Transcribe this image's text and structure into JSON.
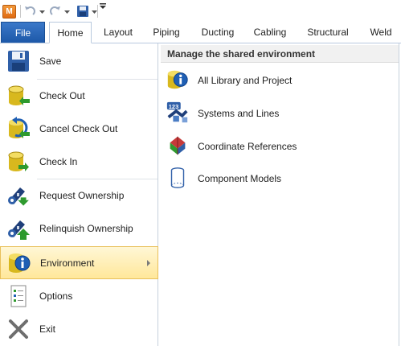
{
  "app": {
    "icon_letter": "M"
  },
  "qat": {
    "icons": [
      "app-icon",
      "undo-icon",
      "redo-icon",
      "save-icon",
      "customize-icon"
    ]
  },
  "ribbon": {
    "file_label": "File",
    "tabs": [
      {
        "label": "Home"
      },
      {
        "label": "Layout"
      },
      {
        "label": "Piping"
      },
      {
        "label": "Ducting"
      },
      {
        "label": "Cabling"
      },
      {
        "label": "Structural"
      },
      {
        "label": "Weld"
      }
    ]
  },
  "menu": {
    "items": [
      {
        "label": "Save",
        "icon": "save-icon"
      },
      {
        "label": "Check Out",
        "icon": "check-out-icon"
      },
      {
        "label": "Cancel Check Out",
        "icon": "cancel-check-out-icon"
      },
      {
        "label": "Check In",
        "icon": "check-in-icon"
      },
      {
        "label": "Request Ownership",
        "icon": "request-ownership-icon"
      },
      {
        "label": "Relinquish Ownership",
        "icon": "relinquish-ownership-icon"
      },
      {
        "label": "Environment",
        "icon": "environment-icon"
      },
      {
        "label": "Options",
        "icon": "options-icon"
      },
      {
        "label": "Exit",
        "icon": "exit-icon"
      }
    ],
    "selected": "Environment"
  },
  "panel": {
    "title": "Manage the shared environment",
    "items": [
      {
        "label": "All Library and Project",
        "icon": "info-database-icon"
      },
      {
        "label": "Systems and Lines",
        "icon": "systems-lines-icon"
      },
      {
        "label": "Coordinate References",
        "icon": "coordinate-axes-icon"
      },
      {
        "label": "Component Models",
        "icon": "cylinder-model-icon"
      }
    ]
  },
  "colors": {
    "file_tab": "#1d58a8",
    "highlight": "#ffe79a",
    "accent_green": "#2e9a2e",
    "accent_blue": "#1f5fb4",
    "db_yellow": "#d8b81e"
  }
}
